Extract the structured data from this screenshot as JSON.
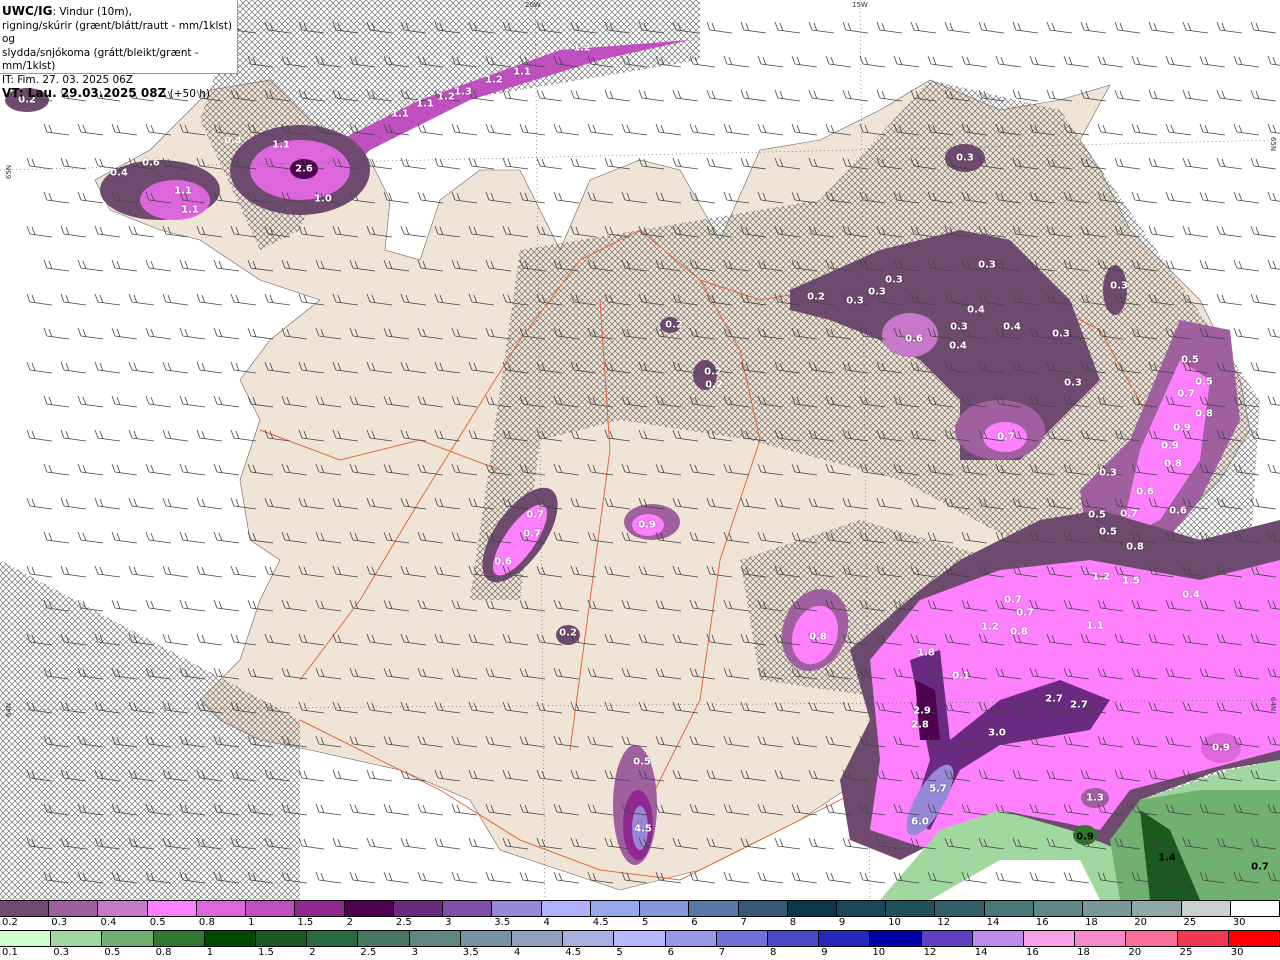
{
  "header": {
    "model": "UWC/IG",
    "line1": ": Vindur (10m),",
    "line2": "rigning/skúrir (grænt/blátt/rautt - mm/1klst) og",
    "line3": "slydda/snjókoma (grátt/bleikt/grænt - mm/1klst)",
    "init_time": "IT: Fim. 27. 03. 2025 06Z",
    "valid_time": "VT: Lau. 29.03.2025 08Z",
    "lead": "(+50 h)"
  },
  "grid_labels": [
    "20W",
    "15W",
    "65N",
    "65N",
    "64N",
    "64N"
  ],
  "map_values": [
    "0.2",
    "1.2",
    "1.1",
    "1.2",
    "1.3",
    "1.2",
    "1.1",
    "1.1",
    "0.4",
    "1.1",
    "2.6",
    "1.0",
    "0.4",
    "0.6",
    "1.1",
    "1.1",
    "0.3",
    "0.3",
    "0.3",
    "0.3",
    "0.3",
    "0.2",
    "0.4",
    "0.4",
    "0.3",
    "0.3",
    "0.4",
    "0.6",
    "0.3",
    "0.7",
    "0.3",
    "0.5",
    "0.5",
    "0.7",
    "0.8",
    "0.9",
    "0.9",
    "0.8",
    "0.3",
    "0.6",
    "0.5",
    "0.7",
    "0.6",
    "0.5",
    "0.8",
    "0.2",
    "0.2",
    "0.2",
    "0.7",
    "0.7",
    "0.6",
    "0.9",
    "0.2",
    "0.8",
    "1.2",
    "1.5",
    "0.4",
    "0.7",
    "0.7",
    "1.2",
    "0.8",
    "1.1",
    "1.8",
    "0.1",
    "2.7",
    "2.7",
    "2.9",
    "2.8",
    "3.0",
    "0.9",
    "5.7",
    "1.3",
    "6.0",
    "0.9",
    "1.4",
    "0.7",
    "0.5",
    "4.5"
  ],
  "legend_snow": {
    "labels": [
      "0.2",
      "0.3",
      "0.4",
      "0.5",
      "0.8",
      "1",
      "1.5",
      "2",
      "2.5",
      "3",
      "3.5",
      "4",
      "4.5",
      "5",
      "6",
      "7",
      "8",
      "9",
      "10",
      "12",
      "14",
      "16",
      "18",
      "20",
      "25",
      "30"
    ],
    "colors": [
      "#6e4a6e",
      "#a060a0",
      "#c878c8",
      "#ff80ff",
      "#dd66dd",
      "#c050c0",
      "#902890",
      "#500050",
      "#6a2a80",
      "#8050a8",
      "#9888d8",
      "#b0b0ff",
      "#98a8e8",
      "#8898d8",
      "#5878a8",
      "#385878",
      "#0a3848",
      "#184858",
      "#205058",
      "#306068",
      "#487878",
      "#608888",
      "#7a9898",
      "#90a8a8",
      "#c8d0d0",
      "#ffffff"
    ]
  },
  "legend_rain": {
    "labels": [
      "0.1",
      "0.3",
      "0.5",
      "0.8",
      "1",
      "1.5",
      "2",
      "2.5",
      "3",
      "3.5",
      "4",
      "4.5",
      "5",
      "6",
      "7",
      "8",
      "9",
      "10",
      "12",
      "14",
      "16",
      "18",
      "20",
      "25",
      "30"
    ],
    "colors": [
      "#ccffcc",
      "#a0d8a0",
      "#70b070",
      "#307830",
      "#004800",
      "#1a5a20",
      "#2a6a40",
      "#487860",
      "#608880",
      "#7890a0",
      "#90a0c0",
      "#a8b0e0",
      "#b8b8ff",
      "#9898e8",
      "#7070d8",
      "#4848c8",
      "#2828b8",
      "#0000a8",
      "#6040c0",
      "#c088e8",
      "#f8a0e8",
      "#f888c8",
      "#f87098",
      "#f03850",
      "#ff0000"
    ]
  },
  "colors": {
    "land": "#f0e4d6",
    "roads": "#e8683a",
    "sea": "#ffffff"
  }
}
